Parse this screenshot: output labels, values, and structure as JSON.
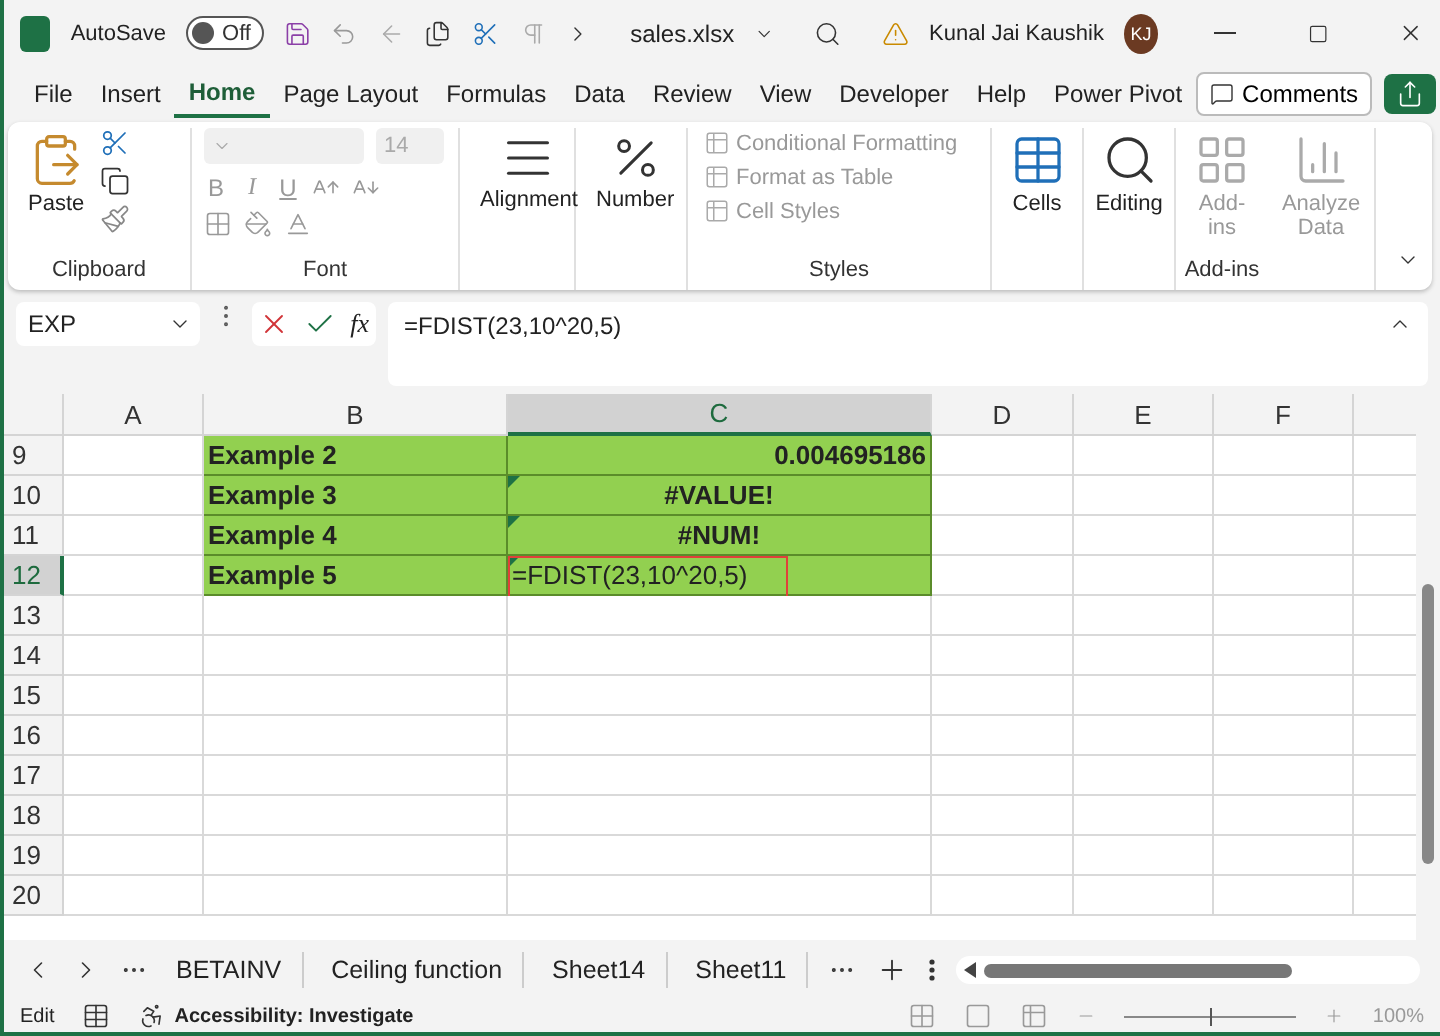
{
  "title_bar": {
    "autosave_label": "AutoSave",
    "autosave": {
      "on": false,
      "label": "Off"
    },
    "file_name": "sales.xlsx",
    "user_name": "Kunal Jai Kaushik",
    "avatar_initials": "KJ"
  },
  "menu": {
    "tabs": [
      {
        "label": "File",
        "selected": false
      },
      {
        "label": "Insert",
        "selected": false
      },
      {
        "label": "Home",
        "selected": true
      },
      {
        "label": "Page Layout",
        "selected": false
      },
      {
        "label": "Formulas",
        "selected": false
      },
      {
        "label": "Data",
        "selected": false
      },
      {
        "label": "Review",
        "selected": false
      },
      {
        "label": "View",
        "selected": false
      },
      {
        "label": "Developer",
        "selected": false
      },
      {
        "label": "Help",
        "selected": false
      },
      {
        "label": "Power Pivot",
        "selected": false
      }
    ],
    "comments_button": "Comments"
  },
  "ribbon": {
    "clipboard": {
      "paste": "Paste",
      "label": "Clipboard"
    },
    "font": {
      "size": "14",
      "style_buttons": [
        "B",
        "I",
        "U"
      ],
      "label": "Font"
    },
    "alignment": "Alignment",
    "number": "Number",
    "styles": {
      "items": [
        {
          "label": "Conditional Formatting",
          "disabled": true
        },
        {
          "label": "Format as Table",
          "disabled": true
        },
        {
          "label": "Cell Styles",
          "disabled": true
        }
      ],
      "label": "Styles"
    },
    "big_buttons": [
      {
        "label": "Cells",
        "kind": "cells",
        "disabled": false
      },
      {
        "label": "Editing",
        "kind": "editing",
        "disabled": false
      },
      {
        "label": "Add-ins",
        "kind": "addins",
        "disabled": true
      },
      {
        "label": "Analyze Data",
        "kind": "analyze",
        "disabled": true
      }
    ],
    "addins_label": "Add-ins"
  },
  "formula_bar": {
    "name_box": "EXP",
    "fx_label": "fx",
    "formula": "=FDIST(23,10^20,5)"
  },
  "sheet": {
    "columns": [
      {
        "label": "A",
        "selected": false
      },
      {
        "label": "B",
        "selected": false
      },
      {
        "label": "C",
        "selected": true
      },
      {
        "label": "D",
        "selected": false
      },
      {
        "label": "E",
        "selected": false
      },
      {
        "label": "F",
        "selected": false
      }
    ],
    "rows": [
      {
        "label": "9",
        "selected": false,
        "cells": [
          {
            "text": "Example 2",
            "kind": "label",
            "error_flag": false
          },
          {
            "text": "0.004695186",
            "kind": "number",
            "error_flag": false
          }
        ]
      },
      {
        "label": "10",
        "selected": false,
        "cells": [
          {
            "text": "Example 3",
            "kind": "label",
            "error_flag": false
          },
          {
            "text": "#VALUE!",
            "kind": "error",
            "error_flag": true
          }
        ]
      },
      {
        "label": "11",
        "selected": false,
        "cells": [
          {
            "text": "Example 4",
            "kind": "label",
            "error_flag": false
          },
          {
            "text": "#NUM!",
            "kind": "error",
            "error_flag": true
          }
        ]
      },
      {
        "label": "12",
        "selected": true,
        "cells": [
          {
            "text": "Example 5",
            "kind": "label",
            "error_flag": false
          },
          {
            "text": "=FDIST(23,10^20,5)",
            "kind": "editing",
            "error_flag": true
          }
        ]
      },
      {
        "label": "13",
        "selected": false
      },
      {
        "label": "14",
        "selected": false
      },
      {
        "label": "15",
        "selected": false
      },
      {
        "label": "16",
        "selected": false
      },
      {
        "label": "17",
        "selected": false
      },
      {
        "label": "18",
        "selected": false
      },
      {
        "label": "19",
        "selected": false
      },
      {
        "label": "20",
        "selected": false
      }
    ]
  },
  "sheet_tabs": [
    {
      "label": "BETAINV",
      "selected": false
    },
    {
      "label": "Ceiling function",
      "selected": false
    },
    {
      "label": "Sheet14",
      "selected": false
    },
    {
      "label": "Sheet11",
      "selected": false
    }
  ],
  "status_bar": {
    "mode": "Edit",
    "accessibility": "Accessibility: Investigate",
    "zoom": {
      "level": 0.5,
      "reading": "100%"
    }
  }
}
